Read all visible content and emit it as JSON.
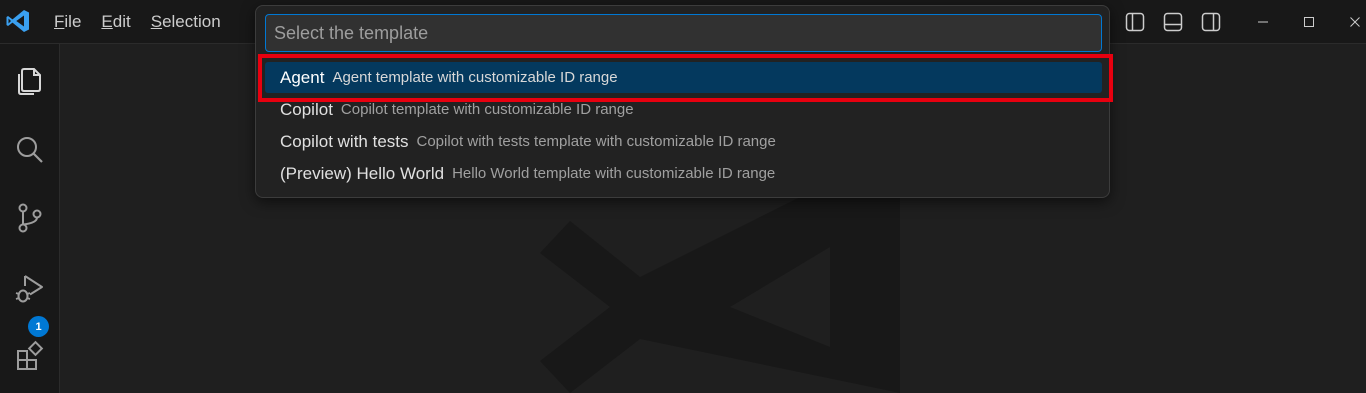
{
  "titlebar": {
    "app_icon": "vscode-logo-icon",
    "menu": [
      {
        "mnemonic": "F",
        "rest": "ile"
      },
      {
        "mnemonic": "E",
        "rest": "dit"
      },
      {
        "mnemonic": "S",
        "rest": "election"
      }
    ],
    "layout_icons": [
      "toggle-primary-sidebar-icon",
      "toggle-panel-icon",
      "toggle-secondary-sidebar-icon"
    ],
    "window_controls": [
      "minimize-icon",
      "maximize-icon",
      "close-icon"
    ]
  },
  "activity_bar": {
    "items": [
      {
        "name": "explorer",
        "icon": "files-icon"
      },
      {
        "name": "search",
        "icon": "search-icon"
      },
      {
        "name": "source-control",
        "icon": "source-control-icon"
      },
      {
        "name": "run-and-debug",
        "icon": "run-debug-icon"
      },
      {
        "name": "extensions",
        "icon": "extensions-icon",
        "badge": "1"
      }
    ],
    "badge_color": "#0078d4"
  },
  "quick_pick": {
    "placeholder": "Select the template",
    "value": "",
    "items": [
      {
        "label": "Agent",
        "description": "Agent template with customizable ID range",
        "active": true
      },
      {
        "label": "Copilot",
        "description": "Copilot template with customizable ID range",
        "active": false
      },
      {
        "label": "Copilot with tests",
        "description": "Copilot with tests template with customizable ID range",
        "active": false
      },
      {
        "label": "(Preview) Hello World",
        "description": "Hello World template with customizable ID range",
        "active": false
      }
    ]
  },
  "colors": {
    "accent": "#0078d4",
    "active_item_bg": "#04395e",
    "highlight_border": "#e8000f",
    "editor_bg": "#1f1f1f",
    "sidebar_bg": "#181818"
  }
}
